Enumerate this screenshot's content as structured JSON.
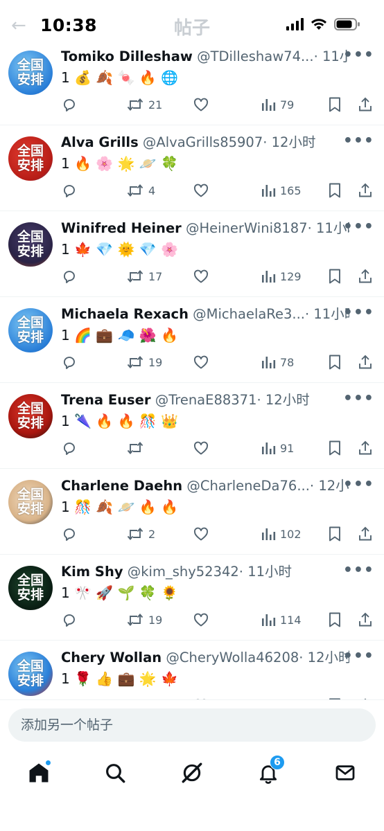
{
  "status_bar": {
    "time": "10:38"
  },
  "header": {
    "title": "帖子",
    "back_icon": "arrow-left-icon"
  },
  "posts": [
    {
      "name": "Tomiko Dilleshaw",
      "handle": "@TDilleshaw74...",
      "time": "· 11小时",
      "content": "1 💰 🍂 🍬 🔥 🌐",
      "retweets": "21",
      "views": "79",
      "avatar": {
        "text": "全国安排",
        "bg": "radial-gradient(circle at 40% 35%, #7ec8f5, #2a7fd8 70%, #1c5cb0)"
      }
    },
    {
      "name": "Alva Grills",
      "handle": "@AlvaGrills85907",
      "time": "· 12小时",
      "content": "1 🔥 🌸 🌟 🪐 🍀",
      "retweets": "4",
      "views": "165",
      "avatar": {
        "text": "全国安排",
        "bg": "radial-gradient(circle at 40% 40%, #e33b2f, #b51c16 70%, #2d4f9e)"
      }
    },
    {
      "name": "Winifred Heiner",
      "handle": "@HeinerWini8187",
      "time": "· 11小时",
      "content": "1 🍁 💎 🌞 💎 🌸",
      "retweets": "17",
      "views": "129",
      "avatar": {
        "text": "全国安排",
        "bg": "radial-gradient(circle at 50% 40%, #4a3e6e, #2a2346 65%, #a14a2f)"
      }
    },
    {
      "name": "Michaela Rexach",
      "handle": "@MichaelaRe3...",
      "time": "· 11小时",
      "content": "1 🌈 💼 🧢 🌺 🔥",
      "retweets": "19",
      "views": "78",
      "avatar": {
        "text": "全国安排",
        "bg": "radial-gradient(circle at 40% 35%, #7ec8f5, #2a7fd8 70%, #1c5cb0)"
      }
    },
    {
      "name": "Trena Euser",
      "handle": "@TrenaE88371",
      "time": "· 12小时",
      "content": "1 🌂 🔥 🔥 🎊 👑",
      "retweets": "",
      "views": "91",
      "avatar": {
        "text": "全国安排",
        "bg": "radial-gradient(circle at 45% 40%, #e0382c, #a8160f 60%, #20120f)"
      }
    },
    {
      "name": "Charlene Daehn",
      "handle": "@CharleneDa76...",
      "time": "· 12小时",
      "content": "1 🎊 🍂 🪐 🔥 🔥",
      "retweets": "2",
      "views": "102",
      "avatar": {
        "text": "全国安排",
        "bg": "radial-gradient(circle at 45% 45%, #f3dcc0, #d9b48a 60%, #1e2530)"
      }
    },
    {
      "name": "Kim Shy",
      "handle": "@kim_shy52342",
      "time": "· 11小时",
      "content": "1 🎌 🚀 🌱 🍀 🌻",
      "retweets": "19",
      "views": "114",
      "avatar": {
        "text": "全国安排",
        "bg": "radial-gradient(circle at 45% 45%, #1f4a2e, #0b2216 60%, #050a08)"
      }
    },
    {
      "name": "Chery Wollan",
      "handle": "@CheryWolla46208",
      "time": "· 12小时",
      "content": "1 🌹 👍 💼 🌟 🍁",
      "retweets": "",
      "views": "",
      "avatar": {
        "text": "全国安排",
        "bg": "radial-gradient(circle at 40% 35%, #7ec8f5, #2a7fd8 60%, #c5281d)"
      }
    }
  ],
  "composer": {
    "placeholder": "添加另一个帖子"
  },
  "bottom_nav": {
    "items": [
      "home-icon",
      "search-icon",
      "grok-icon",
      "notifications-icon",
      "messages-icon"
    ],
    "notification_count": "6"
  },
  "colors": {
    "accent": "#1d9bf0",
    "text_secondary": "#536471",
    "divider": "#eff3f4"
  }
}
